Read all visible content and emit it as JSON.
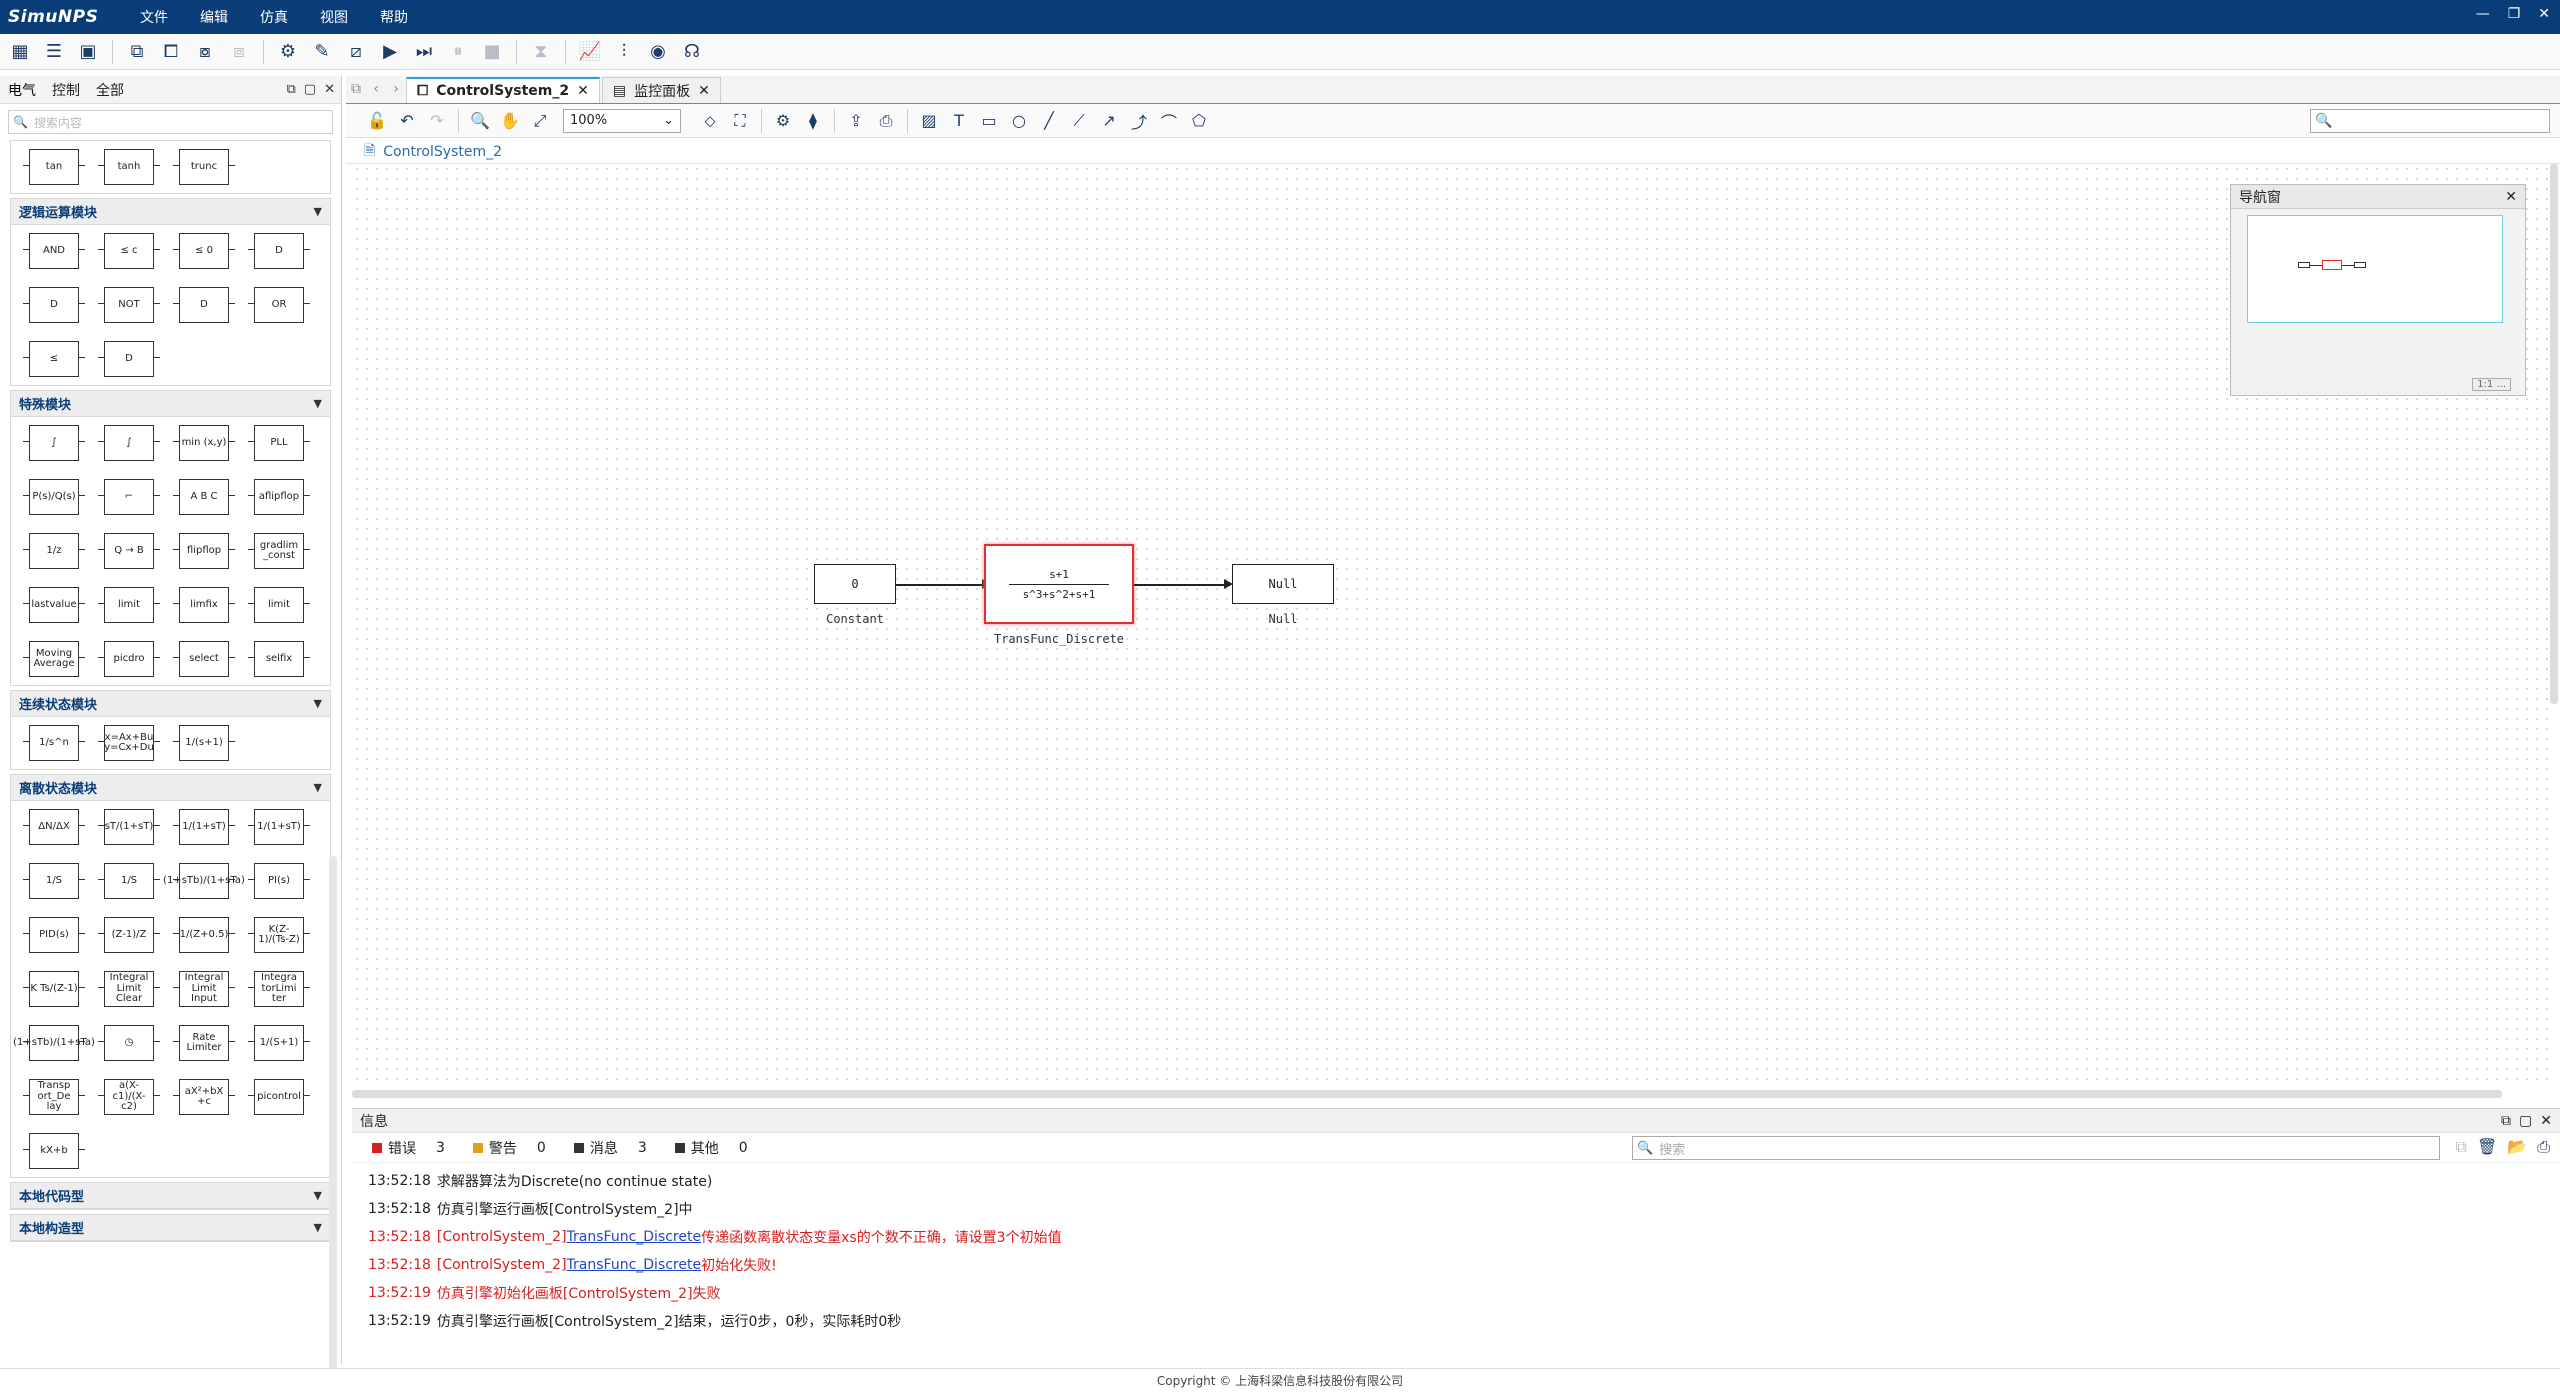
{
  "app": {
    "logo": "SimuNPS",
    "menu": [
      "文件",
      "编辑",
      "仿真",
      "视图",
      "帮助"
    ],
    "window_controls": [
      "—",
      "❐",
      "✕"
    ]
  },
  "left_panel": {
    "tabs": [
      "电气",
      "控制",
      "全部"
    ],
    "search_placeholder": "搜索内容",
    "top_blocks": [
      "tan",
      "tanh",
      "trunc"
    ],
    "sections": [
      {
        "title": "逻辑运算模块",
        "blocks": [
          "AND",
          "≤ c",
          "≤ 0",
          "D",
          "D",
          "NOT",
          "D",
          "OR",
          "≤",
          "D"
        ]
      },
      {
        "title": "特殊模块",
        "blocks": [
          "∫",
          "∫",
          "min (x,y)",
          "PLL",
          "P(s)/Q(s)",
          "⌐",
          "A B C",
          "aflipflop",
          "1/z",
          "Q → B",
          "flipflop",
          "gradlim _const",
          "lastvalue",
          "limit",
          "limfix",
          "limit",
          "Moving Average",
          "picdro",
          "select",
          "selfix"
        ]
      },
      {
        "title": "连续状态模块",
        "blocks": [
          "1/s^n",
          "x=Ax+Bu y=Cx+Du",
          "1/(s+1)"
        ]
      },
      {
        "title": "离散状态模块",
        "blocks": [
          "ΔN/ΔX",
          "sT/(1+sT)",
          "1/(1+sT)",
          "1/(1+sT)",
          "1/S",
          "1/S",
          "(1+sTb)/(1+sTa)",
          "PI(s)",
          "PID(s)",
          "(Z-1)/Z",
          "1/(Z+0.5)",
          "K(Z-1)/(Ts-Z)",
          "K Ts/(Z-1)",
          "Integral Limit Clear",
          "Integral Limit Input",
          "Integra torLimi ter",
          "(1+sTb)/(1+sTa)",
          "◷",
          "Rate Limiter",
          "1/(S+1)",
          "Transp ort_De lay",
          "a(X-c1)/(X-c2)",
          "aX²+bX +c",
          "picontrol",
          "kX+b"
        ]
      }
    ],
    "collapsed_sections": [
      "本地代码型",
      "本地构造型"
    ]
  },
  "editor": {
    "tabs": [
      {
        "label": "ControlSystem_2",
        "active": true
      },
      {
        "label": "监控面板",
        "active": false
      }
    ],
    "zoom": "100%",
    "breadcrumb": "ControlSystem_2"
  },
  "diagram": {
    "blocks": [
      {
        "id": "constant",
        "text": "0",
        "label": "Constant"
      },
      {
        "id": "transfunc",
        "numerator": "s+1",
        "denominator": "s^3+s^2+s+1",
        "label": "TransFunc_Discrete",
        "error": true
      },
      {
        "id": "null",
        "text": "Null",
        "label": "Null"
      }
    ]
  },
  "navigator": {
    "title": "导航窗",
    "status": "1:1 ..."
  },
  "info": {
    "title": "信息",
    "tabs": [
      {
        "label": "错误",
        "count": "3",
        "color": "#d81e1e"
      },
      {
        "label": "警告",
        "count": "0",
        "color": "#e0a020"
      },
      {
        "label": "消息",
        "count": "3",
        "color": "#333333"
      },
      {
        "label": "其他",
        "count": "0",
        "color": "#333333"
      }
    ],
    "search_placeholder": "搜索",
    "logs": [
      {
        "time": "13:52:18",
        "pre": "求解器算法为Discrete(no continue state)",
        "link": "",
        "post": "",
        "error": false
      },
      {
        "time": "13:52:18",
        "pre": "仿真引擎运行画板[ControlSystem_2]中",
        "link": "",
        "post": "",
        "error": false
      },
      {
        "time": "13:52:18",
        "pre": "[ControlSystem_2] ",
        "link": "TransFunc_Discrete",
        "post": "传递函数离散状态变量xs的个数不正确，请设置3个初始值",
        "error": true
      },
      {
        "time": "13:52:18",
        "pre": "[ControlSystem_2] ",
        "link": "TransFunc_Discrete",
        "post": "初始化失败!",
        "error": true
      },
      {
        "time": "13:52:19",
        "pre": "仿真引擎初始化画板[ControlSystem_2]失败",
        "link": "",
        "post": "",
        "error": true
      },
      {
        "time": "13:52:19",
        "pre": "仿真引擎运行画板[ControlSystem_2]结束，运行0步，0秒，实际耗时0秒",
        "link": "",
        "post": "",
        "error": false
      }
    ]
  },
  "footer": "Copyright © 上海科梁信息科技股份有限公司"
}
